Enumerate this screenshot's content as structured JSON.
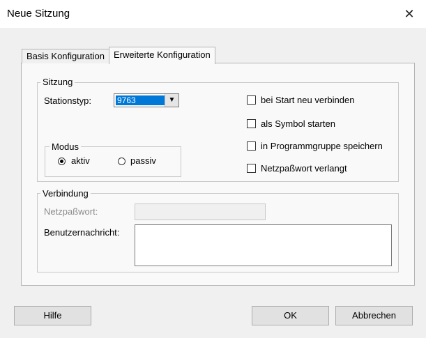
{
  "window": {
    "title": "Neue Sitzung",
    "close_glyph": "✕"
  },
  "tabs": [
    {
      "label": "Basis Konfiguration",
      "active": false
    },
    {
      "label": "Erweiterte Konfiguration",
      "active": true
    }
  ],
  "sitzung": {
    "group_label": "Sitzung",
    "station_type": {
      "label": "Stationstyp:",
      "value": "9763",
      "dropdown_glyph": "▼"
    },
    "options": [
      {
        "label": "bei Start neu verbinden",
        "checked": false
      },
      {
        "label": "als Symbol starten",
        "checked": false
      },
      {
        "label": "in Programmgruppe speichern",
        "checked": false
      },
      {
        "label": "Netzpaßwort verlangt",
        "checked": false
      }
    ]
  },
  "modus": {
    "group_label": "Modus",
    "options": [
      {
        "label": "aktiv",
        "selected": true
      },
      {
        "label": "passiv",
        "selected": false
      }
    ]
  },
  "verbindung": {
    "group_label": "Verbindung",
    "password": {
      "label": "Netzpaßwort:",
      "value": "",
      "enabled": false
    },
    "user_message": {
      "label": "Benutzernachricht:",
      "value": ""
    }
  },
  "buttons": {
    "help": "Hilfe",
    "ok": "OK",
    "cancel": "Abbrechen"
  },
  "colors": {
    "accent": "#0078d7",
    "dialog_bg": "#f0f0f0",
    "panel_bg": "#f9f9f9"
  }
}
